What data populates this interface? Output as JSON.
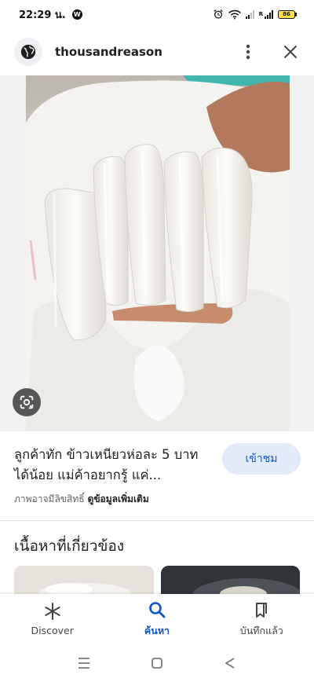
{
  "status_bar": {
    "time": "22:29 น.",
    "app_badge": "W",
    "battery": "86",
    "network_label": "R"
  },
  "header": {
    "site_name": "thousandreason",
    "site_icon": "globe-icon",
    "more_icon": "more-vert-icon",
    "close_icon": "close-icon"
  },
  "result": {
    "title": "ลูกค้าทัก ข้าวเหนียวห่อละ 5 บาทได้น้อย แม่ค้าอยากรู้ แค่...",
    "visit_label": "เข้าชม",
    "copyright_text": "ภาพอาจมีลิขสิทธิ์",
    "more_info_label": "ดูข้อมูลเพิ่มเติม"
  },
  "related": {
    "title": "เนื้อหาที่เกี่ยวข้อง"
  },
  "bottom_nav": [
    {
      "label": "Discover",
      "icon": "asterisk-icon",
      "active": false
    },
    {
      "label": "ค้นหา",
      "icon": "search-icon",
      "active": true
    },
    {
      "label": "บันทึกแล้ว",
      "icon": "bookmark-icon",
      "active": false
    }
  ],
  "colors": {
    "accent": "#0b57d0",
    "visit_button_bg": "#e3ebfa"
  }
}
